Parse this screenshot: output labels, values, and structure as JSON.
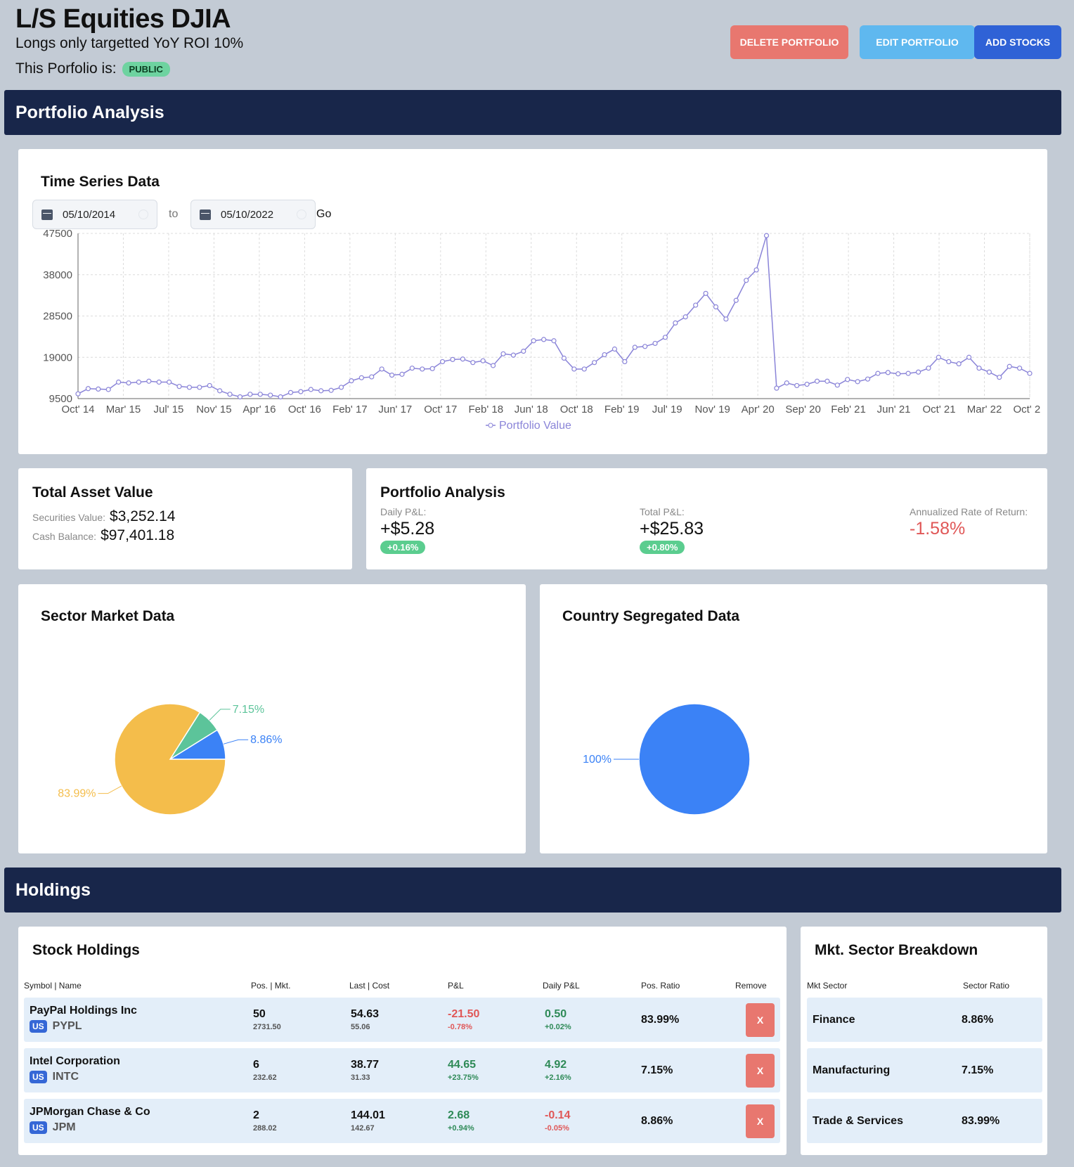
{
  "header": {
    "title": "L/S Equities DJIA",
    "subtitle": "Longs only targetted YoY ROI 10%",
    "visibility_label": "This Porfolio is:",
    "visibility_badge": "PUBLIC",
    "delete_label": "DELETE PORTFOLIO",
    "edit_label": "EDIT PORTFOLIO",
    "add_label": "ADD STOCKS"
  },
  "bands": {
    "analysis": "Portfolio Analysis",
    "holdings": "Holdings"
  },
  "timeseries": {
    "title": "Time Series Data",
    "from_date": "05/10/2014",
    "to_label": "to",
    "to_date": "05/10/2022",
    "go_label": "Go"
  },
  "chart_data": [
    {
      "type": "line",
      "title": "Time Series Data",
      "series": [
        {
          "name": "Portfolio Value",
          "color": "#8a84d8"
        }
      ],
      "y": [
        10600,
        11800,
        11700,
        11600,
        13300,
        13100,
        13300,
        13500,
        13300,
        13300,
        12300,
        12100,
        12100,
        12500,
        11300,
        10500,
        9900,
        10500,
        10500,
        10300,
        9900,
        10900,
        11100,
        11600,
        11300,
        11400,
        12100,
        13600,
        14300,
        14500,
        16300,
        14900,
        15100,
        16500,
        16300,
        16400,
        18000,
        18500,
        18600,
        17800,
        18200,
        17100,
        19800,
        19500,
        20400,
        22800,
        23100,
        22800,
        18800,
        16300,
        16300,
        17800,
        19600,
        20900,
        18000,
        21300,
        21500,
        22200,
        23600,
        26900,
        28300,
        31000,
        33700,
        30600,
        27800,
        32100,
        36700,
        39100,
        47000,
        11900,
        13100,
        12500,
        12800,
        13500,
        13500,
        12600,
        13900,
        13400,
        14000,
        15300,
        15500,
        15200,
        15300,
        15600,
        16500,
        19000,
        18000,
        17500,
        19000,
        16500,
        15600,
        14400,
        16900,
        16500,
        15300
      ],
      "x_ticks": [
        "Oct' 14",
        "Mar' 15",
        "Jul' 15",
        "Nov' 15",
        "Apr' 16",
        "Oct' 16",
        "Feb' 17",
        "Jun' 17",
        "Oct' 17",
        "Feb' 18",
        "Jun' 18",
        "Oct' 18",
        "Feb' 19",
        "Jul' 19",
        "Nov' 19",
        "Apr' 20",
        "Sep' 20",
        "Feb' 21",
        "Jun' 21",
        "Oct' 21",
        "Mar' 22",
        "Oct' 22"
      ],
      "y_ticks": [
        9500,
        19000,
        28500,
        38000,
        47500
      ],
      "ylim": [
        9500,
        47500
      ],
      "grid": true,
      "legend": "bottom"
    },
    {
      "type": "pie",
      "title": "Sector Market Data",
      "slices": [
        {
          "label": "83.99%",
          "value": 83.99,
          "color": "#f4bd4b"
        },
        {
          "label": "7.15%",
          "value": 7.15,
          "color": "#5cc49a"
        },
        {
          "label": "8.86%",
          "value": 8.86,
          "color": "#3b82f6"
        }
      ]
    },
    {
      "type": "pie",
      "title": "Country Segregated Data",
      "slices": [
        {
          "label": "100%",
          "value": 100,
          "color": "#3b82f6"
        }
      ]
    }
  ],
  "asset": {
    "title": "Total Asset Value",
    "securities_label": "Securities Value:",
    "securities_value": "$3,252.14",
    "cash_label": "Cash Balance:",
    "cash_value": "$97,401.18"
  },
  "analysis": {
    "title": "Portfolio Analysis",
    "daily_label": "Daily P&L:",
    "daily_value": "+$5.28",
    "daily_pct": "+0.16%",
    "total_label": "Total P&L:",
    "total_value": "+$25.83",
    "total_pct": "+0.80%",
    "arr_label": "Annualized Rate of Return:",
    "arr_value": "-1.58%"
  },
  "sector_chart": {
    "title": "Sector Market Data"
  },
  "country_chart": {
    "title": "Country Segregated Data"
  },
  "holdings": {
    "title": "Stock Holdings",
    "columns": [
      "Symbol | Name",
      "Pos. | Mkt.",
      "Last | Cost",
      "P&L",
      "Daily P&L",
      "Pos. Ratio",
      "Remove"
    ],
    "remove_label": "X",
    "rows": [
      {
        "name": "PayPal Holdings Inc",
        "country": "US",
        "ticker": "PYPL",
        "pos": "50",
        "mkt": "2731.50",
        "last": "54.63",
        "cost": "55.06",
        "pnl": "-21.50",
        "pnl_pct": "-0.78%",
        "daily": "0.50",
        "daily_pct": "+0.02%",
        "ratio": "83.99%"
      },
      {
        "name": "Intel Corporation",
        "country": "US",
        "ticker": "INTC",
        "pos": "6",
        "mkt": "232.62",
        "last": "38.77",
        "cost": "31.33",
        "pnl": "44.65",
        "pnl_pct": "+23.75%",
        "daily": "4.92",
        "daily_pct": "+2.16%",
        "ratio": "7.15%"
      },
      {
        "name": "JPMorgan Chase & Co",
        "country": "US",
        "ticker": "JPM",
        "pos": "2",
        "mkt": "288.02",
        "last": "144.01",
        "cost": "142.67",
        "pnl": "2.68",
        "pnl_pct": "+0.94%",
        "daily": "-0.14",
        "daily_pct": "-0.05%",
        "ratio": "8.86%"
      }
    ]
  },
  "sectors": {
    "title": "Mkt. Sector Breakdown",
    "columns": [
      "Mkt Sector",
      "Sector Ratio"
    ],
    "rows": [
      {
        "sector": "Finance",
        "ratio": "8.86%"
      },
      {
        "sector": "Manufacturing",
        "ratio": "7.15%"
      },
      {
        "sector": "Trade & Services",
        "ratio": "83.99%"
      }
    ]
  }
}
